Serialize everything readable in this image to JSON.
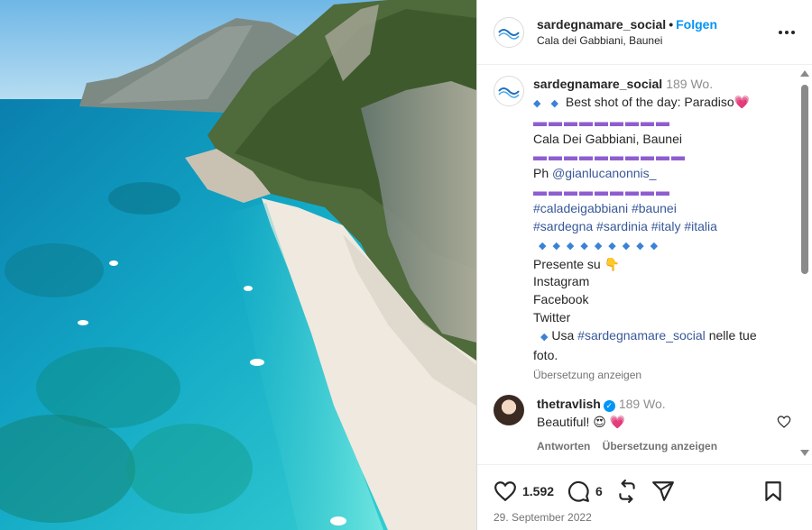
{
  "post": {
    "username": "sardegnamare_social",
    "separator": "•",
    "follow_label": "Folgen",
    "location": "Cala dei Gabbiani, Baunei",
    "more_icon": "more-icon"
  },
  "caption": {
    "username": "sardegnamare_social",
    "time": "189 Wo.",
    "line1_diamonds": "◆ ◆",
    "line1_text": "Best shot of the day: Paradiso",
    "line1_emoji": "💗",
    "separator1": "▬▬▬▬▬▬▬▬▬",
    "place": "Cala Dei Gabbiani, Baunei",
    "separator2": "▬▬▬▬▬▬▬▬▬▬",
    "ph_label": "Ph",
    "ph_handle": "@gianlucanonnis_",
    "separator3": "▬▬▬▬▬▬▬▬▬",
    "hashtags1": "#caladeigabbiani #baunei",
    "hashtags2": "#sardegna #sardinia #italy #italia",
    "diamond_row": "◆◆◆◆◆◆◆◆◆",
    "presente": "Presente su",
    "presente_emoji": "👇",
    "network1": "Instagram",
    "network2": "Facebook",
    "network3": "Twitter",
    "usa_diamond": "◆",
    "usa_prefix": "Usa",
    "usa_tag": "#sardegnamare_social",
    "usa_suffix": "nelle tue",
    "usa_end": "foto.",
    "translate": "Übersetzung anzeigen"
  },
  "comment": {
    "username": "thetravlish",
    "verified_mark": "✓",
    "time": "189 Wo.",
    "text": "Beautiful!",
    "emojis": "😍 💗",
    "reply": "Antworten",
    "translate": "Übersetzung anzeigen"
  },
  "actions": {
    "likes": "1.592",
    "comments": "6",
    "date": "29. September 2022"
  },
  "colors": {
    "link": "#0095f6",
    "hashtag": "#385898",
    "muted": "#737373",
    "separator": "#8e5ecf",
    "diamond": "#3b82d6"
  }
}
